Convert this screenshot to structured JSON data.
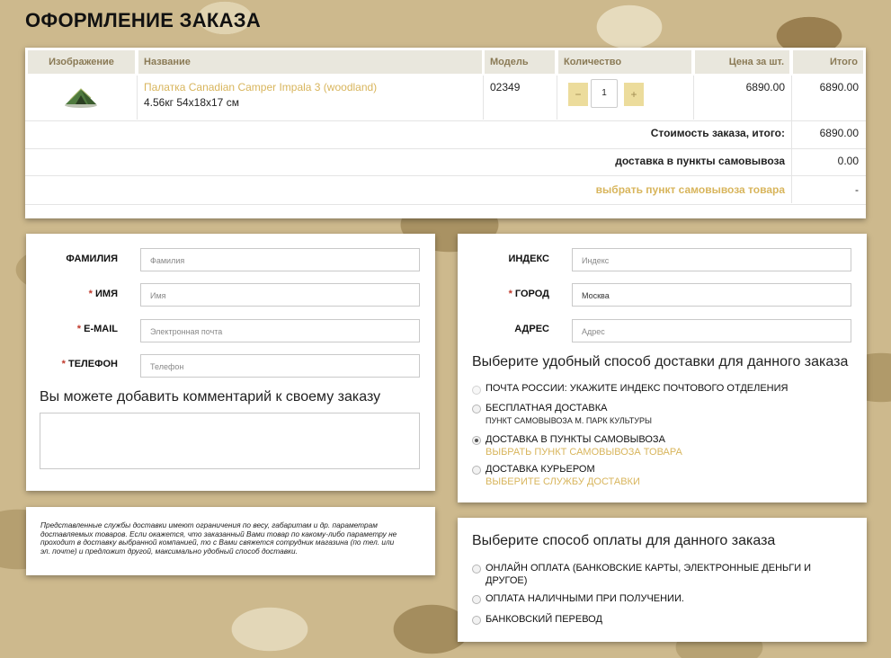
{
  "page_title": "ОФОРМЛЕНИЕ ЗАКАЗА",
  "cart": {
    "headers": [
      "Изображение",
      "Название",
      "Модель",
      "Количество",
      "Цена за шт.",
      "Итого"
    ],
    "item": {
      "image_icon": "tent-image",
      "name": "Палатка Canadian Camper Impala 3 (woodland)",
      "details": "4.56кг 54x18x17 см",
      "model": "02349",
      "quantity": "1",
      "minus": "−",
      "plus": "+",
      "price": "6890.00",
      "total": "6890.00"
    },
    "summary": [
      {
        "label": "Стоимость заказа, итого:",
        "value": "6890.00"
      },
      {
        "label": "доставка в пункты самовывоза",
        "value": "0.00"
      },
      {
        "label": "выбрать пункт самовывоза товара",
        "value": "-"
      }
    ]
  },
  "customer": {
    "surname_label": "ФАМИЛИЯ",
    "surname_placeholder": "Фамилия",
    "name_label": "ИМЯ",
    "name_placeholder": "Имя",
    "email_label": "E-MAIL",
    "email_placeholder": "Электронная почта",
    "phone_label": "ТЕЛЕФОН",
    "phone_placeholder": "Телефон",
    "required_mark": "*",
    "comment_heading": "Вы можете добавить комментарий к своему заказу",
    "comment_value": ""
  },
  "note": "Представленные службы доставки имеют ограничения по весу, габаритам и др. параметрам доставляемых товаров. Если окажется, что заказанный Вами товар по какому-либо параметру не проходит в доставку выбранной компанией, то с Вами свяжется сотрудник магазина (по тел. или эл. почте) и предложит другой, максимально удобный способ доставки.",
  "address": {
    "index_label": "ИНДЕКС",
    "index_placeholder": "Индекс",
    "city_label": "ГОРОД",
    "city_value": "Москва",
    "address_label": "АДРЕС",
    "address_placeholder": "Адрес",
    "required_mark": "*"
  },
  "delivery": {
    "heading": "Выберите удобный способ доставки для данного заказа",
    "options": [
      {
        "label": "ПОЧТА РОССИИ: УКАЖИТЕ ИНДЕКС ПОЧТОВОГО ОТДЕЛЕНИЯ",
        "sub": "",
        "link": "",
        "selected": false,
        "disabled": true
      },
      {
        "label": "БЕСПЛАТНАЯ ДОСТАВКА",
        "sub": "ПУНКТ САМОВЫВОЗА М. ПАРК КУЛЬТУРЫ",
        "link": "",
        "selected": false,
        "disabled": false
      },
      {
        "label": "ДОСТАВКА В ПУНКТЫ САМОВЫВОЗА",
        "sub": "",
        "link": "ВЫБРАТЬ ПУНКТ САМОВЫВОЗА ТОВАРА",
        "selected": true,
        "disabled": false
      },
      {
        "label": "ДОСТАВКА КУРЬЕРОМ",
        "sub": "",
        "link": "ВЫБЕРИТЕ СЛУЖБУ ДОСТАВКИ",
        "selected": false,
        "disabled": false
      }
    ]
  },
  "payment": {
    "heading": "Выберите способ оплаты для данного заказа",
    "options": [
      {
        "label": "ОНЛАЙН ОПЛАТА (БАНКОВСКИЕ КАРТЫ, ЭЛЕКТРОННЫЕ ДЕНЬГИ И ДРУГОЕ)",
        "selected": false
      },
      {
        "label": "ОПЛАТА НАЛИЧНЫМИ ПРИ ПОЛУЧЕНИИ.",
        "selected": false
      },
      {
        "label": "БАНКОВСКИЙ ПЕРЕВОД",
        "selected": false
      }
    ]
  },
  "colors": {
    "accent": "#d8b55c",
    "header_bg": "#e9e7dd",
    "qty_button": "#ecdc9c",
    "required": "#c0392b"
  }
}
